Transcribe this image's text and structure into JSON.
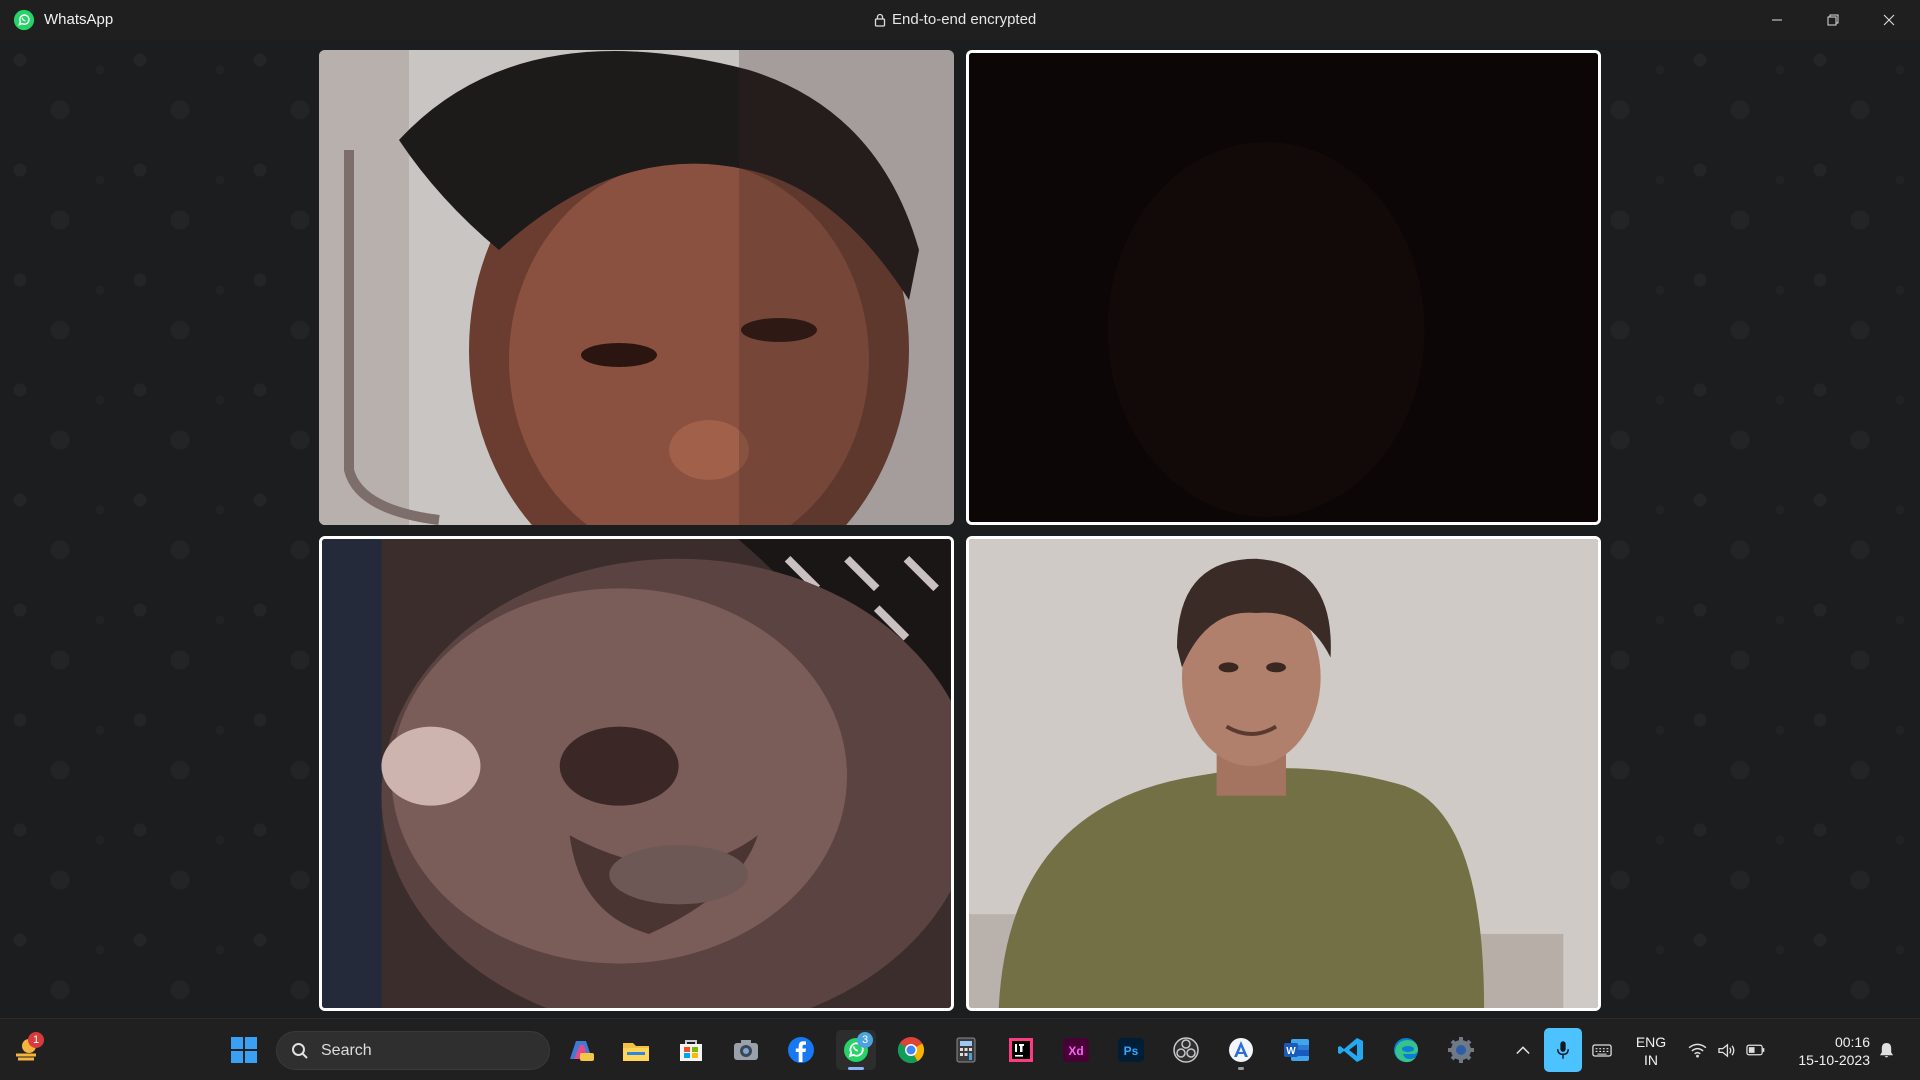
{
  "titlebar": {
    "app_name": "WhatsApp",
    "encryption_label": "End-to-end encrypted",
    "controls": [
      "minimize-icon",
      "restore-icon",
      "close-icon"
    ]
  },
  "call": {
    "participants": [
      {
        "tile": "participant-1",
        "video": "on",
        "active_speaker": false
      },
      {
        "tile": "participant-2",
        "video": "dark",
        "active_speaker": true
      },
      {
        "tile": "participant-3",
        "video": "on",
        "active_speaker": true
      },
      {
        "tile": "participant-4",
        "video": "on",
        "active_speaker": true
      }
    ]
  },
  "taskbar": {
    "weather_badge": "1",
    "search_placeholder": "Search",
    "whatsapp_badge": "3",
    "pinned_apps": [
      "start-icon",
      "copilot-pre-icon",
      "file-explorer-icon",
      "microsoft-store-icon",
      "camera-icon",
      "facebook-icon",
      "whatsapp-icon",
      "chrome-icon",
      "calculator-icon",
      "intellij-icon",
      "adobe-xd-icon",
      "photoshop-icon",
      "obs-icon",
      "app-installer-icon",
      "word-icon",
      "vscode-icon",
      "edge-icon",
      "settings-icon"
    ],
    "tray": {
      "language_line1": "ENG",
      "language_line2": "IN",
      "time": "00:16",
      "date": "15-10-2023"
    }
  },
  "colors": {
    "accent_whatsapp": "#25d366",
    "active_border": "#ffffff",
    "taskbar_bg": "#202020",
    "mic_active": "#4cc2ff"
  }
}
